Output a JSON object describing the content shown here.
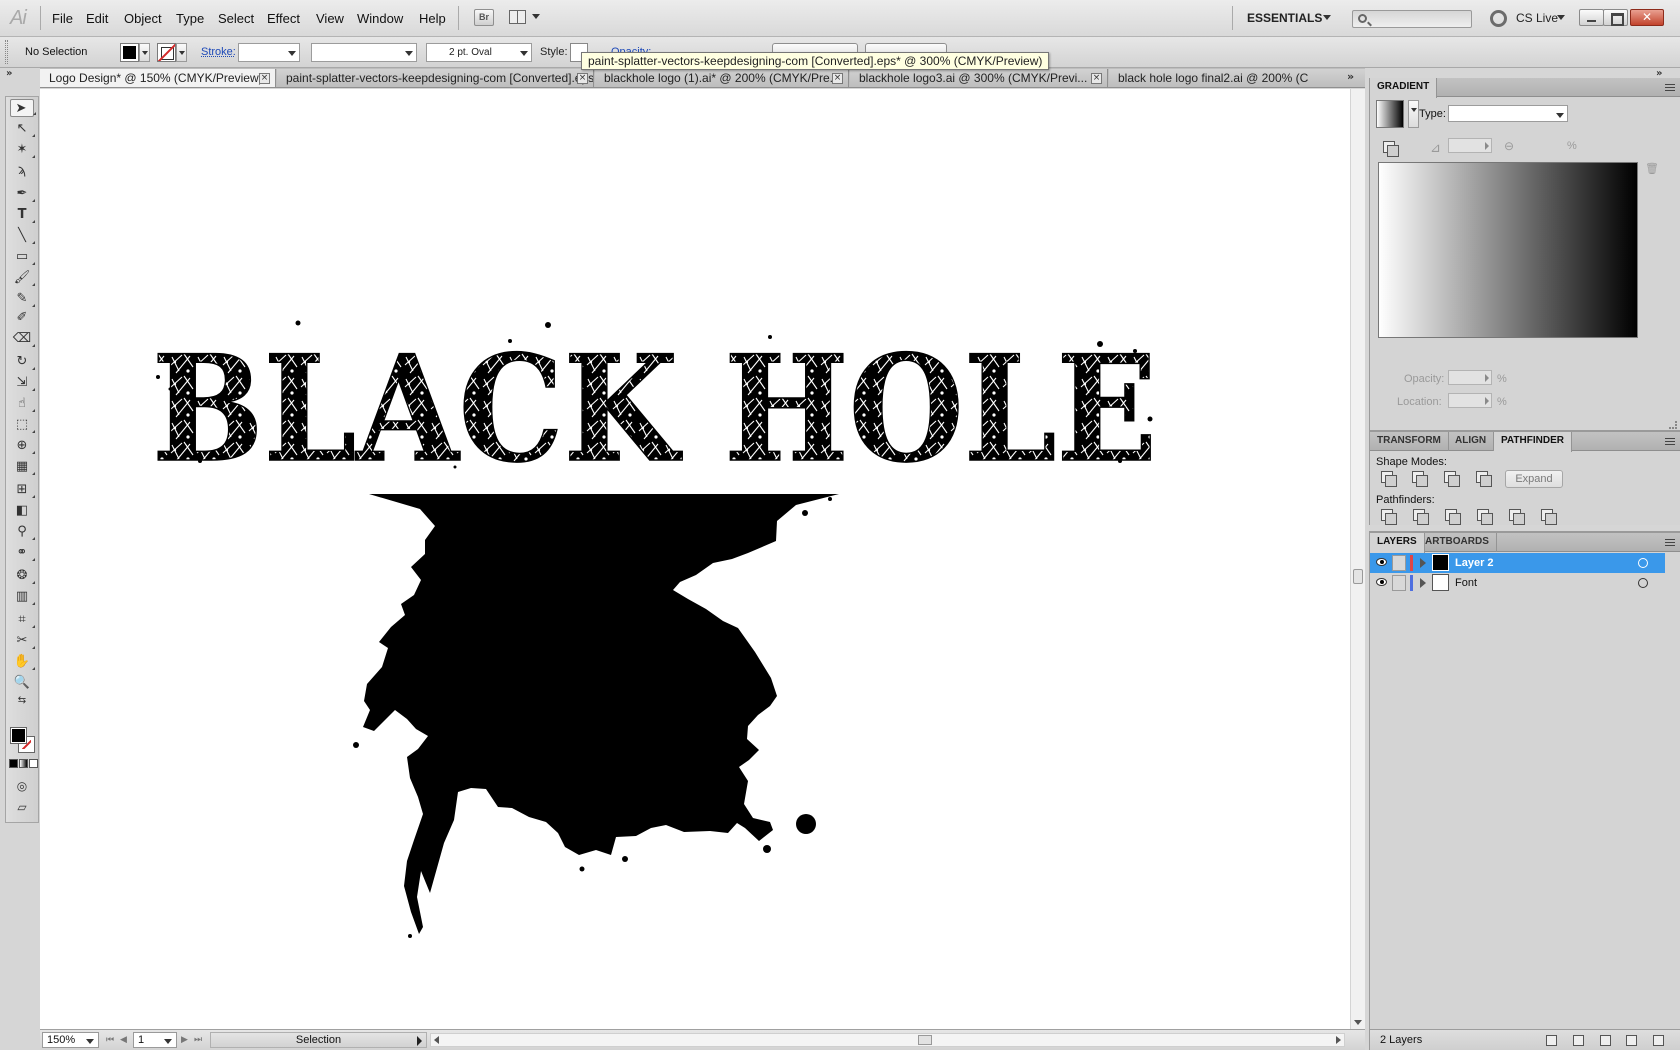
{
  "app": {
    "logo": "Ai"
  },
  "menu": [
    "File",
    "Edit",
    "Object",
    "Type",
    "Select",
    "Effect",
    "View",
    "Window",
    "Help"
  ],
  "menu_extras": {
    "bridge": "Br",
    "workspace": "ESSENTIALS",
    "cslive": "CS Live"
  },
  "control": {
    "selection": "No Selection",
    "stroke_label": "Stroke:",
    "brush": "2 pt. Oval",
    "style_label": "Style:",
    "opacity_label": "Opacity:"
  },
  "tooltip": "paint-splatter-vectors-keepdesigning-com [Converted].eps* @ 300% (CMYK/Preview)",
  "tabs": [
    {
      "label": "Logo Design* @ 150% (CMYK/Preview)",
      "active": true
    },
    {
      "label": "paint-splatter-vectors-keepdesigning-com [Converted].eps*",
      "active": false
    },
    {
      "label": "blackhole logo (1).ai* @ 200% (CMYK/Pre...",
      "active": false
    },
    {
      "label": "blackhole logo3.ai @ 300% (CMYK/Previ...",
      "active": false
    },
    {
      "label": "black hole logo final2.ai @ 200% (C",
      "active": false
    }
  ],
  "artwork": {
    "title": "BLACK HOLE"
  },
  "status": {
    "zoom": "150%",
    "page": "1",
    "tool": "Selection"
  },
  "gradient_panel": {
    "tab": "GRADIENT",
    "type_label": "Type:",
    "percent": "%",
    "opacity_label": "Opacity:",
    "location_label": "Location:"
  },
  "pathfinder_panel": {
    "tabs": [
      "TRANSFORM",
      "ALIGN",
      "PATHFINDER"
    ],
    "shape_modes": "Shape Modes:",
    "expand": "Expand",
    "pathfinders": "Pathfinders:"
  },
  "layers_panel": {
    "tabs": [
      "LAYERS",
      "ARTBOARDS"
    ],
    "layers": [
      {
        "name": "Layer 2",
        "color": "#e04646",
        "selected": true
      },
      {
        "name": "Font",
        "color": "#4f6fe0",
        "selected": false
      }
    ],
    "count": "2 Layers"
  },
  "colors": {
    "selection": "#3a98ea",
    "canvas": "#ffffff",
    "ui_gray": "#d4d4d4"
  },
  "icons": [
    "search-icon",
    "cs-live-icon",
    "minimize-icon",
    "maximize-icon",
    "close-icon",
    "eye-icon",
    "target-icon"
  ]
}
